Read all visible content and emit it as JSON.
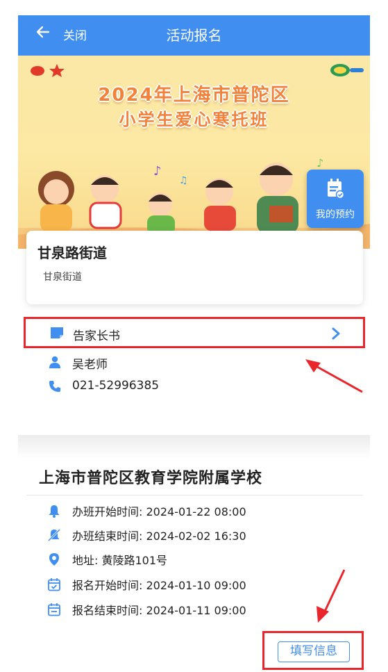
{
  "header": {
    "close_label": "关闭",
    "title": "活动报名",
    "back_icon": "arrow-left-icon"
  },
  "banner": {
    "title_line1": "2024年上海市普陀区",
    "title_line2": "小学生爱心寒托班"
  },
  "my_booking": {
    "label": "我的预约",
    "icon": "calendar-check-icon"
  },
  "org": {
    "name": "甘泉路街道",
    "subtitle": "甘泉街道"
  },
  "notice": {
    "label": "告家长书",
    "icon": "document-icon",
    "chevron": "chevron-right-icon"
  },
  "contact": {
    "teacher": "吴老师",
    "phone": "021-52996385"
  },
  "school": {
    "name": "上海市普陀区教育学院附属学校",
    "items": [
      {
        "icon": "bell-icon",
        "text": "办班开始时间: 2024-01-22 08:00"
      },
      {
        "icon": "bell-off-icon",
        "text": "办班结束时间: 2024-02-02 16:30"
      },
      {
        "icon": "location-pin-icon",
        "text": "地址: 黄陵路101号"
      },
      {
        "icon": "calendar-check-icon",
        "text": "报名开始时间: 2024-01-10 09:00"
      },
      {
        "icon": "calendar-minus-icon",
        "text": "报名结束时间: 2024-01-11 09:00"
      }
    ],
    "fill_button": "填写信息"
  },
  "colors": {
    "primary": "#3f8ef0",
    "highlight": "#e8262b",
    "banner_title": "#f2813a"
  }
}
